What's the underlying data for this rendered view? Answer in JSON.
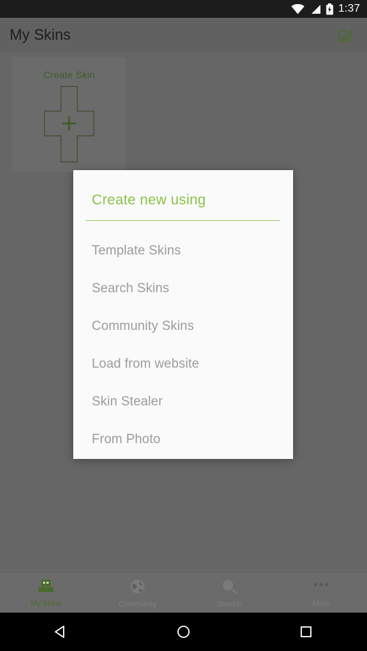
{
  "status_bar": {
    "time": "1:37",
    "icons": [
      "wifi-icon",
      "signal-icon",
      "battery-charging-icon"
    ]
  },
  "app_bar": {
    "title": "My Skins",
    "edit_icon": "edit-square-icon"
  },
  "content": {
    "create_skin_card": {
      "label": "Create Skin",
      "plus_icon": "plus-icon",
      "shape_icon": "skin-template-cross-icon"
    }
  },
  "dialog": {
    "title": "Create new using",
    "items": [
      {
        "label": "Template Skins"
      },
      {
        "label": "Search Skins"
      },
      {
        "label": "Community Skins"
      },
      {
        "label": "Load from website"
      },
      {
        "label": "Skin Stealer"
      },
      {
        "label": "From Photo"
      }
    ]
  },
  "bottom_nav": {
    "items": [
      {
        "label": "My Skins",
        "icon": "minecraft-head-icon",
        "active": true
      },
      {
        "label": "Community",
        "icon": "globe-icon",
        "active": false
      },
      {
        "label": "Search",
        "icon": "magnifier-icon",
        "active": false
      },
      {
        "label": "More",
        "icon": "more-dots-icon",
        "active": false
      }
    ]
  },
  "system_nav": {
    "back": "back-triangle-icon",
    "home": "home-circle-icon",
    "recents": "recents-square-icon"
  },
  "colors": {
    "accent_green": "#8bc34a",
    "divider_green": "#9ccc65",
    "scrim_gray": "#666666",
    "app_bar_gray": "#616161",
    "dialog_bg": "#fafafa",
    "item_text": "#9b9b9b",
    "status_bar": "#1c1c1c",
    "system_nav": "#000000"
  }
}
